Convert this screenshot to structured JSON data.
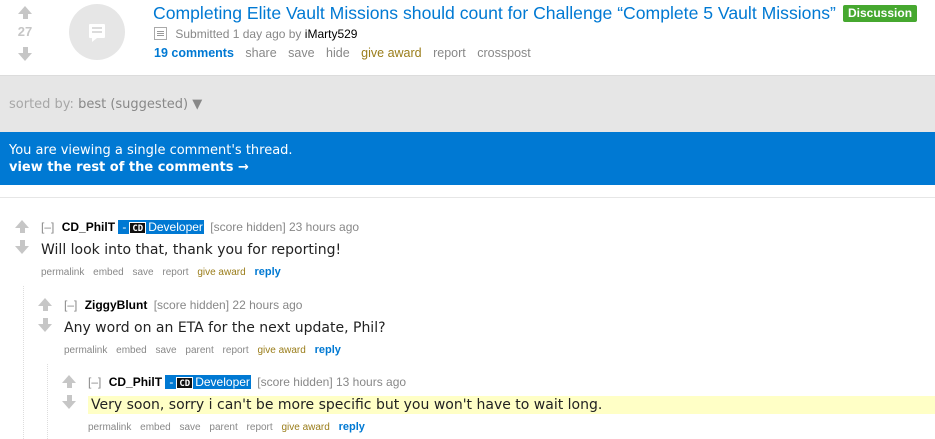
{
  "post": {
    "score": "27",
    "title": "Completing Elite Vault Missions should count for Challenge “Complete 5 Vault Missions”",
    "flair": "Discussion",
    "submitted_text": "Submitted 1 day ago by",
    "author": "iMarty529",
    "buttons": {
      "comments": "19 comments",
      "share": "share",
      "save": "save",
      "hide": "hide",
      "give_award": "give award",
      "report": "report",
      "crosspost": "crosspost"
    }
  },
  "sort": {
    "label": "sorted by:",
    "selected": "best (suggested) ▼"
  },
  "notice": {
    "line1": "You are viewing a single comment's thread.",
    "line2": "view the rest of the comments →"
  },
  "comments": [
    {
      "expand": "[–]",
      "author": "CD_PhilT",
      "flair_sep": "-",
      "flair_logo": "CD",
      "flair_text": "Developer",
      "score": "[score hidden]",
      "time": "23 hours ago",
      "text": "Will look into that, thank you for reporting!",
      "buttons": {
        "permalink": "permalink",
        "embed": "embed",
        "save": "save",
        "report": "report",
        "give_award": "give award",
        "reply": "reply"
      }
    },
    {
      "expand": "[–]",
      "author": "ZiggyBlunt",
      "score": "[score hidden]",
      "time": "22 hours ago",
      "text": "Any word on an ETA for the next update, Phil?",
      "buttons": {
        "permalink": "permalink",
        "embed": "embed",
        "save": "save",
        "parent": "parent",
        "report": "report",
        "give_award": "give award",
        "reply": "reply"
      }
    },
    {
      "expand": "[–]",
      "author": "CD_PhilT",
      "flair_sep": "-",
      "flair_logo": "CD",
      "flair_text": "Developer",
      "score": "[score hidden]",
      "time": "13 hours ago",
      "text": "Very soon, sorry i can't be more specific but you won't have to wait long.",
      "buttons": {
        "permalink": "permalink",
        "embed": "embed",
        "save": "save",
        "parent": "parent",
        "report": "report",
        "give_award": "give award",
        "reply": "reply"
      }
    }
  ],
  "colors": {
    "link_blue": "#0079d3",
    "flair_green": "#46a82f",
    "award_gold": "#9a7d1a",
    "highlight_yellow": "#ffffc6"
  }
}
